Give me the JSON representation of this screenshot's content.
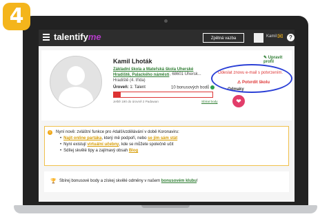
{
  "step_number": "4",
  "nav": {
    "logo_main": "talentify",
    "logo_accent": "me",
    "feedback_button": "Zpětná vazba",
    "user_name": "Kamil",
    "help": "?"
  },
  "profile": {
    "name": "Kamil Lhoták",
    "school": "Základní škola a Mateřská škola Uherské Hradiště, Palackého náměstí",
    "school_address": ", 68601 Uhersk...",
    "city_class": "Hradiště (4. třída)",
    "level_label": "Úroveň:",
    "level_value": "1: Talent",
    "points": "10 bonusových bodů",
    "progress_fraction": 0.07,
    "progress_note": "Ještě 190 do úrovně 2 Padawan",
    "collect_link": "Sbírat body",
    "edit_profile": "Upravit profil",
    "resend_email": "Odeslat znovu e-mail s potvrzením.",
    "confirm_school": "Potvrdit školu",
    "rewards_label": "Odmaky"
  },
  "news": {
    "headline": "Nyní nově: zvláštní funkce pro #dalšívzdělávání v době Koronaviru:",
    "items": [
      {
        "link": "Najít online partáka",
        "mid": ", který mě podpoří, nebo ",
        "link2": "se jím sám stát"
      },
      {
        "pre": "Nyní existují ",
        "link": "virtuální učebny",
        "post": ", kde se můžete společně učit"
      },
      {
        "pre": "Sdílej skvělé tipy a zajímavý obsah ",
        "link": "Blog"
      }
    ]
  },
  "club": {
    "text": "Sbírej bonusové body a získej skvělé odměny v našem ",
    "link": "bonusovém klubu",
    "end": "!"
  }
}
